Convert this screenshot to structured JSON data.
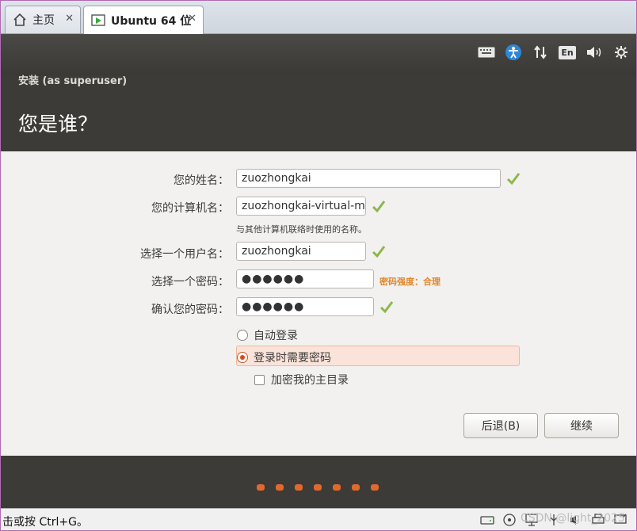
{
  "tabs": [
    {
      "label": "主页",
      "icon": "home-icon",
      "close": "✕"
    },
    {
      "label": "Ubuntu 64 位",
      "icon": "vm-play-icon",
      "close": "✕"
    }
  ],
  "indicators": [
    "keyboard-icon",
    "accessibility-icon",
    "network-icon",
    "keyboard-layout-icon",
    "volume-icon",
    "settings-gear-icon"
  ],
  "indicator_layout_text": "En",
  "installer": {
    "subtitle": "安装 (as superuser)",
    "title": "您是谁？"
  },
  "form": {
    "name_label": "您的姓名：",
    "name_value": "zuozhongkai",
    "computer_label": "您的计算机名：",
    "computer_value": "zuozhongkai-virtual-m",
    "computer_hint": "与其他计算机联络时使用的名称。",
    "username_label": "选择一个用户名：",
    "username_value": "zuozhongkai",
    "password_label": "选择一个密码：",
    "password_value": "●●●●●●",
    "password_strength": "密码强度：合理",
    "confirm_label": "确认您的密码：",
    "confirm_value": "●●●●●●",
    "auto_login": "自动登录",
    "require_password": "登录时需要密码",
    "encrypt_home": "加密我的主目录"
  },
  "buttons": {
    "back": "后退(B)",
    "continue": "继续"
  },
  "progress": {
    "total_steps": 7,
    "current_step": 7
  },
  "statusbar": {
    "text": "击或按 Ctrl+G。",
    "watermark": "CSDN @light_2025"
  },
  "colors": {
    "accent": "#dd4814",
    "check": "#8cb84a",
    "header_bg": "#3c3b37",
    "strength": "#e0862a"
  }
}
